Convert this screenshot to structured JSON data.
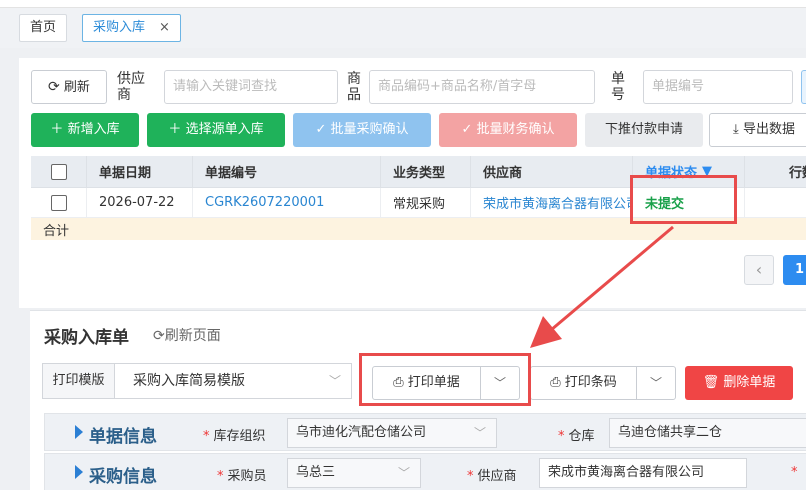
{
  "tabs": [
    {
      "label": "首页"
    },
    {
      "label": "采购入库",
      "close": "×"
    }
  ],
  "search": {
    "refresh_label": "刷新",
    "supplier_label_1": "供应",
    "supplier_label_2": "商",
    "supplier_placeholder": "请输入关键词查找",
    "goods_label_1": "商",
    "goods_label_2": "品",
    "goods_placeholder": "商品编码+商品名称/首字母",
    "doc_label_1": "单",
    "doc_label_2": "号",
    "doc_placeholder": "单据编号"
  },
  "toolbar": {
    "add": "新增入库",
    "select_source": "选择源单入库",
    "batch_purchase_confirm": "批量采购确认",
    "batch_finance_confirm": "批量财务确认",
    "push_payment": "下推付款申请",
    "export": "导出数据"
  },
  "grid": {
    "columns": [
      "单据日期",
      "单据编号",
      "业务类型",
      "供应商",
      "单据状态",
      "行数"
    ],
    "rows": [
      {
        "date": "2026-07-22",
        "doc_no": "CGRK2607220001",
        "biz_type": "常规采购",
        "supplier": "荣成市黄海离合器有限公司",
        "status": "未提交"
      }
    ],
    "total_label": "合计"
  },
  "pager": {
    "prev": "‹",
    "page": "1"
  },
  "detail": {
    "title": "采购入库单",
    "refresh_page": "刷新页面",
    "print_template_label": "打印模版",
    "print_template_value": "采购入库简易模版",
    "print_doc": "打印单据",
    "print_barcode": "打印条码",
    "delete_doc": "删除单据",
    "sections": [
      {
        "title": "单据信息",
        "fields": [
          {
            "label": "库存组织",
            "value": "乌市迪化汽配仓储公司"
          },
          {
            "label": "仓库",
            "value": "乌迪仓储共享二仓"
          }
        ]
      },
      {
        "title": "采购信息",
        "fields": [
          {
            "label": "采购员",
            "value": "乌总三"
          },
          {
            "label": "供应商",
            "value": "荣成市黄海离合器有限公司"
          }
        ]
      }
    ]
  },
  "colors": {
    "accent": "#2d8cf0",
    "green": "#1fb25a",
    "danger": "#f04545",
    "annotation": "#e84b4b"
  }
}
